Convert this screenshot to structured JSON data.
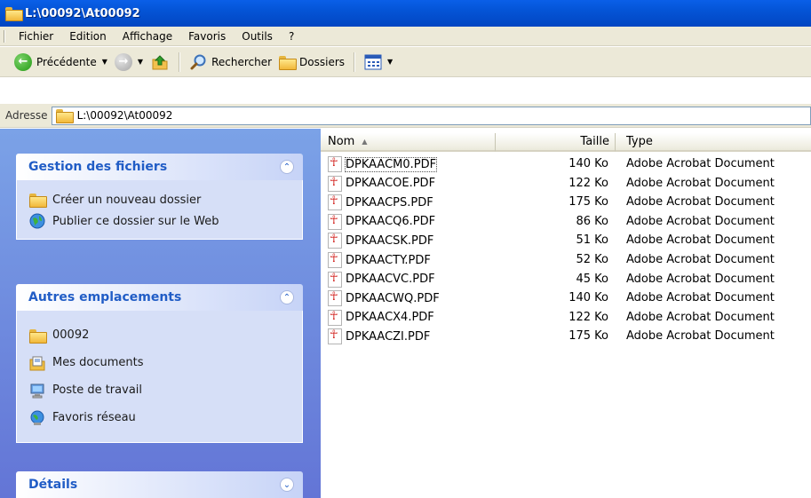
{
  "window": {
    "title": "L:\\00092\\At00092"
  },
  "menubar": {
    "items": [
      "Fichier",
      "Edition",
      "Affichage",
      "Favoris",
      "Outils",
      "?"
    ]
  },
  "toolbar": {
    "back_label": "Précédente",
    "search_label": "Rechercher",
    "folders_label": "Dossiers"
  },
  "address": {
    "label": "Adresse",
    "value": "L:\\00092\\At00092"
  },
  "taskpane": {
    "file_tasks": {
      "title": "Gestion des fichiers",
      "items": [
        "Créer un nouveau dossier",
        "Publier ce dossier sur le Web"
      ]
    },
    "other_places": {
      "title": "Autres emplacements",
      "items": [
        "00092",
        "Mes documents",
        "Poste de travail",
        "Favoris réseau"
      ]
    },
    "details": {
      "title": "Détails"
    }
  },
  "filelist": {
    "columns": {
      "name": "Nom",
      "size": "Taille",
      "type": "Type"
    },
    "rows": [
      {
        "name": "DPKAACM0.PDF",
        "size": "140 Ko",
        "type": "Adobe Acrobat Document"
      },
      {
        "name": "DPKAACOE.PDF",
        "size": "122 Ko",
        "type": "Adobe Acrobat Document"
      },
      {
        "name": "DPKAACPS.PDF",
        "size": "175 Ko",
        "type": "Adobe Acrobat Document"
      },
      {
        "name": "DPKAACQ6.PDF",
        "size": "86 Ko",
        "type": "Adobe Acrobat Document"
      },
      {
        "name": "DPKAACSK.PDF",
        "size": "51 Ko",
        "type": "Adobe Acrobat Document"
      },
      {
        "name": "DPKAACTY.PDF",
        "size": "52 Ko",
        "type": "Adobe Acrobat Document"
      },
      {
        "name": "DPKAACVC.PDF",
        "size": "45 Ko",
        "type": "Adobe Acrobat Document"
      },
      {
        "name": "DPKAACWQ.PDF",
        "size": "140 Ko",
        "type": "Adobe Acrobat Document"
      },
      {
        "name": "DPKAACX4.PDF",
        "size": "122 Ko",
        "type": "Adobe Acrobat Document"
      },
      {
        "name": "DPKAACZI.PDF",
        "size": "175 Ko",
        "type": "Adobe Acrobat Document"
      }
    ]
  }
}
